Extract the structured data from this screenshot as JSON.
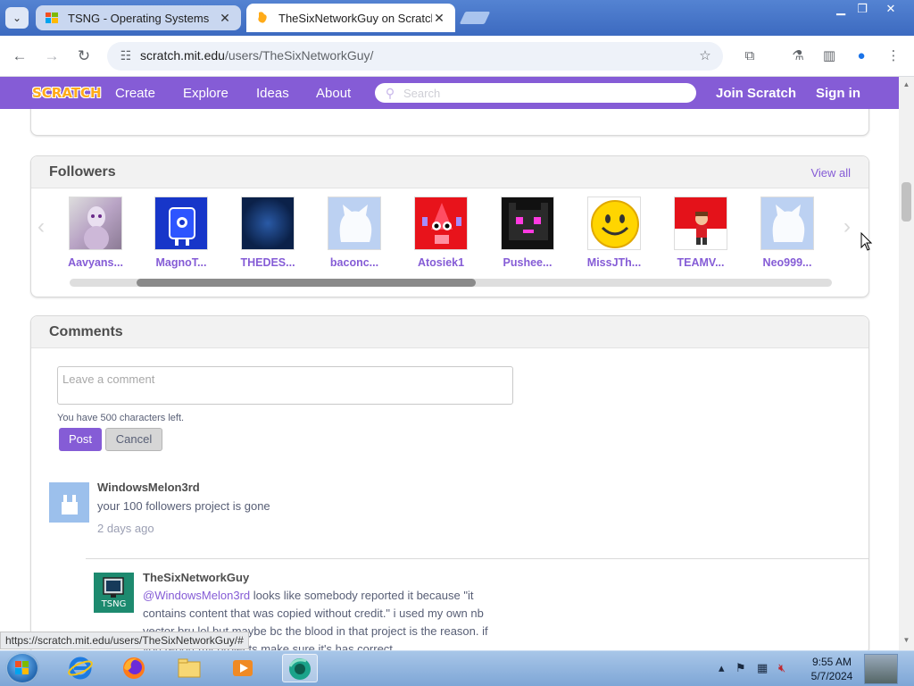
{
  "browser": {
    "tabs": [
      {
        "title": "TSNG - Operating Systems",
        "active": false
      },
      {
        "title": "TheSixNetworkGuy on Scratch",
        "active": true
      }
    ],
    "url_host": "scratch.mit.edu",
    "url_path": "/users/TheSixNetworkGuy/",
    "status_url": "https://scratch.mit.edu/users/TheSixNetworkGuy/#"
  },
  "scratch_nav": {
    "logo": "SCRATCH",
    "links": [
      "Create",
      "Explore",
      "Ideas",
      "About"
    ],
    "search_placeholder": "Search",
    "join": "Join Scratch",
    "signin": "Sign in"
  },
  "followers": {
    "title": "Followers",
    "view_all": "View all",
    "items": [
      {
        "name": "Aavyans...",
        "thumb": "mewtwo-figure"
      },
      {
        "name": "MagnoT...",
        "thumb": "blue-robot"
      },
      {
        "name": "THEDES...",
        "thumb": "dark-blue-tile"
      },
      {
        "name": "baconc...",
        "thumb": "default-cat"
      },
      {
        "name": "Atosiek1",
        "thumb": "red-creature"
      },
      {
        "name": "Pushee...",
        "thumb": "pixel-cat"
      },
      {
        "name": "MissJTh...",
        "thumb": "smiley-face"
      },
      {
        "name": "TEAMV...",
        "thumb": "red-character"
      },
      {
        "name": "Neo999...",
        "thumb": "default-cat"
      }
    ]
  },
  "comments": {
    "title": "Comments",
    "input_placeholder": "Leave a comment",
    "chars_left": "You have 500 characters left.",
    "post": "Post",
    "cancel": "Cancel",
    "list": [
      {
        "user": "WindowsMelon3rd",
        "text": "your 100 followers project is gone",
        "time": "2 days ago"
      },
      {
        "user": "TheSixNetworkGuy",
        "avatar_label": "TSNG",
        "mention": "@WindowsMelon3rd",
        "text_line1": " looks like somebody reported it because \"it",
        "text_line2": "contains content that was copied without credit.\" i used my own nb",
        "text_line3": "vector bru lol but maybe bc the blood in that project is the reason. if",
        "text_line4": "you report my projects make sure it's has correct"
      }
    ]
  },
  "taskbar": {
    "time": "9:55 AM",
    "date": "5/7/2024"
  }
}
